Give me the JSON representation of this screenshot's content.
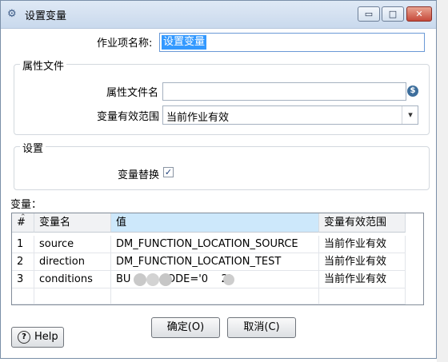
{
  "window": {
    "title": "设置变量",
    "icons": {
      "app": "variable-icon",
      "minimize": "minimize-icon",
      "maximize": "maximize-icon",
      "close": "close-icon"
    },
    "glyphs": {
      "app": "⚙",
      "minimize": "▭",
      "maximize": "□",
      "close": "✕"
    }
  },
  "job_name": {
    "label": "作业项名称:",
    "value": "设置变量"
  },
  "properties_group": {
    "title": "属性文件",
    "file_label": "属性文件名",
    "file_value": "",
    "variable_icon": "dollar-variable-icon",
    "variable_glyph": "$",
    "scope_label": "变量有效范围",
    "scope_value": "当前作业有效",
    "dropdown_glyph": "▾"
  },
  "settings_group": {
    "title": "设置",
    "replace_label": "变量替换",
    "replace_checked": true,
    "check_glyph": "✓"
  },
  "variables": {
    "label": "变量：",
    "sort_glyph": "⌃",
    "columns": [
      "#",
      "变量名",
      "值",
      "变量有效范围"
    ],
    "rows": [
      {
        "num": "1",
        "name": "source",
        "value": "DM_FUNCTION_LOCATION_SOURCE",
        "scope": "当前作业有效"
      },
      {
        "num": "2",
        "name": "direction",
        "value": "DM_FUNCTION_LOCATION_TEST",
        "scope": "当前作业有效"
      },
      {
        "num": "3",
        "name": "conditions",
        "value": "BU           ODE='0    2'",
        "scope": "当前作业有效"
      }
    ]
  },
  "buttons": {
    "help": "Help",
    "help_glyph": "?",
    "ok": "确定(O)",
    "cancel": "取消(C)"
  },
  "colors": {
    "selection": "#3399ff",
    "header_selected": "#cde8fb",
    "close_button": "#c6493a"
  }
}
